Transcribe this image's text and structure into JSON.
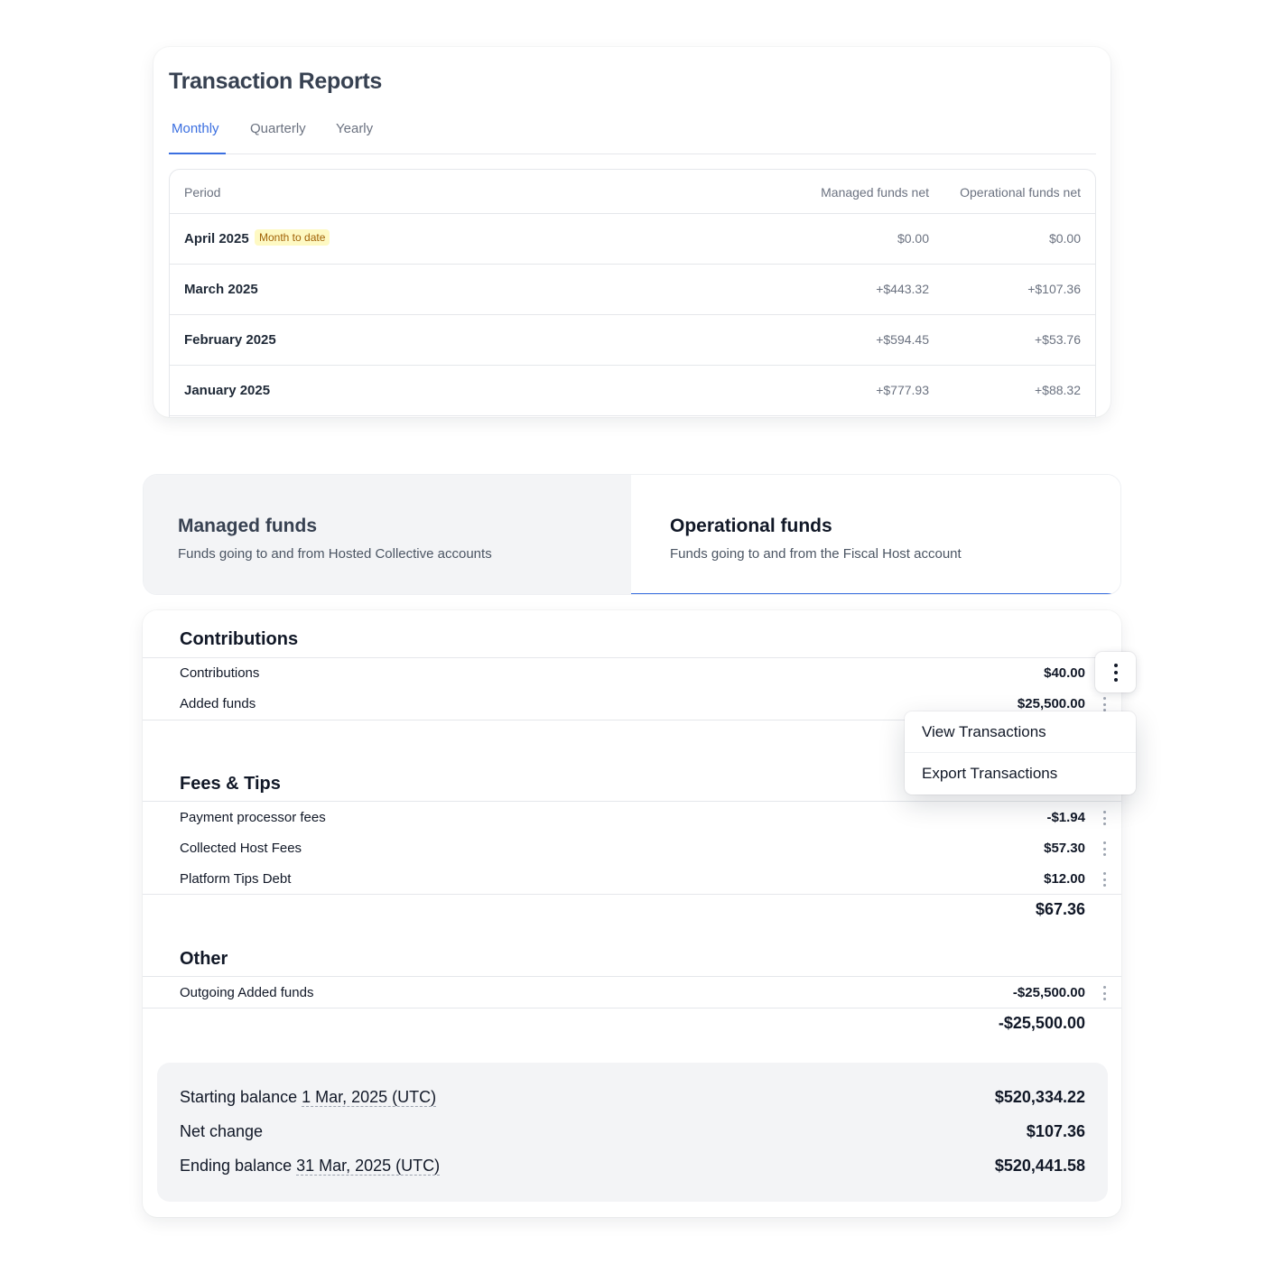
{
  "reports": {
    "title": "Transaction Reports",
    "tabs": [
      {
        "label": "Monthly",
        "active": true
      },
      {
        "label": "Quarterly",
        "active": false
      },
      {
        "label": "Yearly",
        "active": false
      }
    ],
    "columns": {
      "period": "Period",
      "managed": "Managed funds net",
      "operational": "Operational funds net"
    },
    "rows": [
      {
        "period": "April 2025",
        "badge": "Month to date",
        "managed": "$0.00",
        "operational": "$0.00"
      },
      {
        "period": "March 2025",
        "badge": "",
        "managed": "+$443.32",
        "operational": "+$107.36"
      },
      {
        "period": "February 2025",
        "badge": "",
        "managed": "+$594.45",
        "operational": "+$53.76"
      },
      {
        "period": "January 2025",
        "badge": "",
        "managed": "+$777.93",
        "operational": "+$88.32"
      }
    ]
  },
  "funds_tabs": {
    "managed": {
      "title": "Managed funds",
      "subtitle": "Funds going to and from Hosted Collective accounts",
      "active": false
    },
    "operational": {
      "title": "Operational funds",
      "subtitle": "Funds going to and from the Fiscal Host account",
      "active": true
    }
  },
  "breakdown": {
    "contributions": {
      "title": "Contributions",
      "lines": [
        {
          "label": "Contributions",
          "amount": "$40.00"
        },
        {
          "label": "Added funds",
          "amount": "$25,500.00"
        }
      ]
    },
    "fees": {
      "title": "Fees & Tips",
      "lines": [
        {
          "label": "Payment processor fees",
          "amount": "-$1.94"
        },
        {
          "label": "Collected Host Fees",
          "amount": "$57.30"
        },
        {
          "label": "Platform Tips Debt",
          "amount": "$12.00"
        }
      ],
      "total": "$67.36"
    },
    "other": {
      "title": "Other",
      "lines": [
        {
          "label": "Outgoing Added funds",
          "amount": "-$25,500.00"
        }
      ],
      "total": "-$25,500.00"
    },
    "menu": {
      "options": [
        "View Transactions",
        "Export Transactions"
      ]
    },
    "balance": {
      "starting": {
        "label_prefix": "Starting balance ",
        "date": "1 Mar, 2025 (UTC)",
        "amount": "$520,334.22"
      },
      "net": {
        "label": "Net change",
        "amount": "$107.36"
      },
      "ending": {
        "label_prefix": "Ending balance ",
        "date": "31 Mar, 2025 (UTC)",
        "amount": "$520,441.58"
      }
    }
  },
  "colors": {
    "accent": "#3b6fe0",
    "badge_bg": "#fef9c3",
    "badge_text": "#a16207",
    "panel_bg": "#f3f4f6"
  }
}
